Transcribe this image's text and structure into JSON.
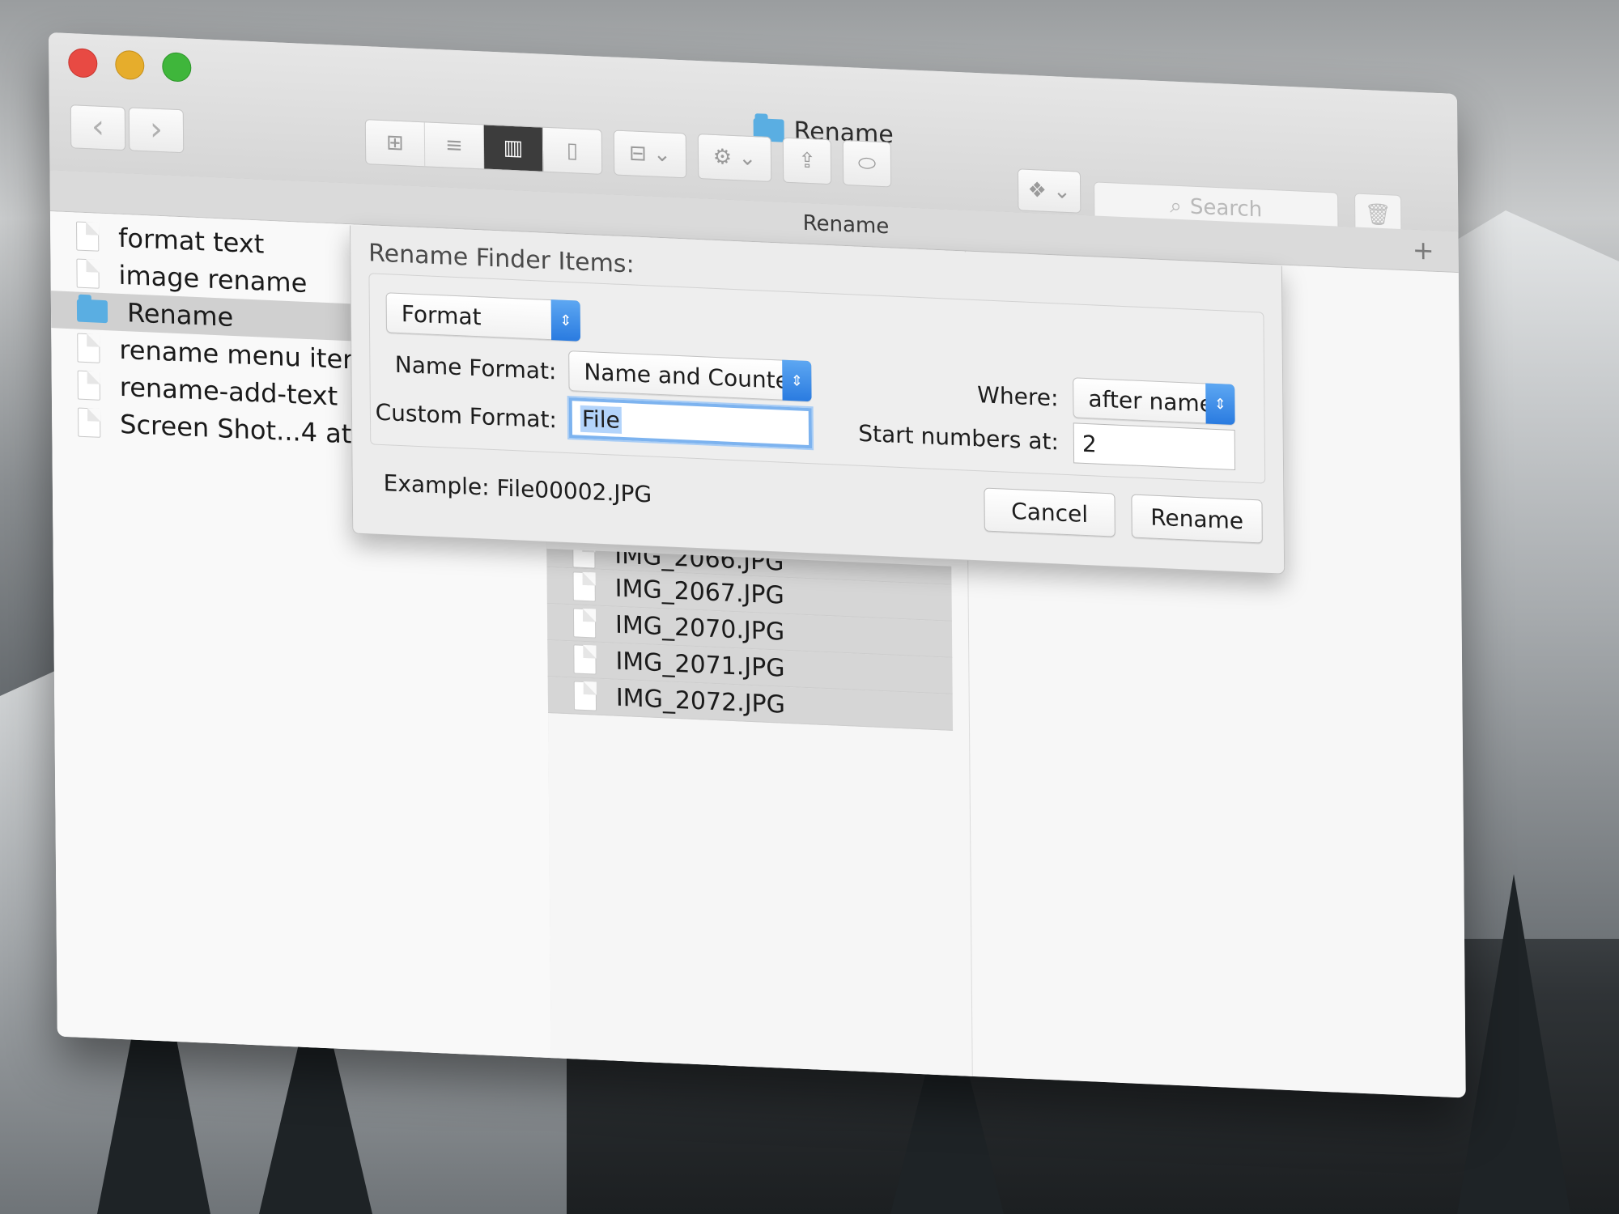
{
  "window": {
    "title": "Rename",
    "path_label": "Rename",
    "add_tab": "+"
  },
  "toolbar": {
    "back": "‹",
    "forward": "›",
    "view_icons": "⊞",
    "view_list": "≡",
    "view_columns": "▥",
    "view_coverflow": "▯",
    "arrange": "⊟ ⌄",
    "action": "⚙ ⌄",
    "share": "⇪",
    "tags": "⬭",
    "dropbox": "❖ ⌄",
    "search_placeholder": "Search",
    "search_icon": "⌕",
    "trash": "🗑"
  },
  "sidebar_files": [
    {
      "name": "format text",
      "type": "doc"
    },
    {
      "name": "image rename",
      "type": "doc"
    },
    {
      "name": "Rename",
      "type": "folder",
      "selected": true
    },
    {
      "name": "rename menu iter",
      "type": "doc"
    },
    {
      "name": "rename-add-text",
      "type": "doc"
    },
    {
      "name": "Screen Shot...4 at",
      "type": "doc"
    }
  ],
  "folder_files": [
    {
      "name": "IMG_2066.JPG",
      "partial": true
    },
    {
      "name": "IMG_2067.JPG"
    },
    {
      "name": "IMG_2070.JPG"
    },
    {
      "name": "IMG_2071.JPG"
    },
    {
      "name": "IMG_2072.JPG"
    }
  ],
  "rename_sheet": {
    "title": "Rename Finder Items:",
    "mode": "Format",
    "name_format_label": "Name Format:",
    "name_format_value": "Name and Counter",
    "where_label": "Where:",
    "where_value": "after name",
    "custom_format_label": "Custom Format:",
    "custom_format_value": "File",
    "start_numbers_label": "Start numbers at:",
    "start_numbers_value": "2",
    "example": "Example: File00002.JPG",
    "cancel": "Cancel",
    "rename": "Rename",
    "stepper_glyph": "⇕"
  },
  "colors": {
    "accent": "#2a7be0",
    "focus_ring": "#7db3ef",
    "selection": "#d0d0d0"
  }
}
